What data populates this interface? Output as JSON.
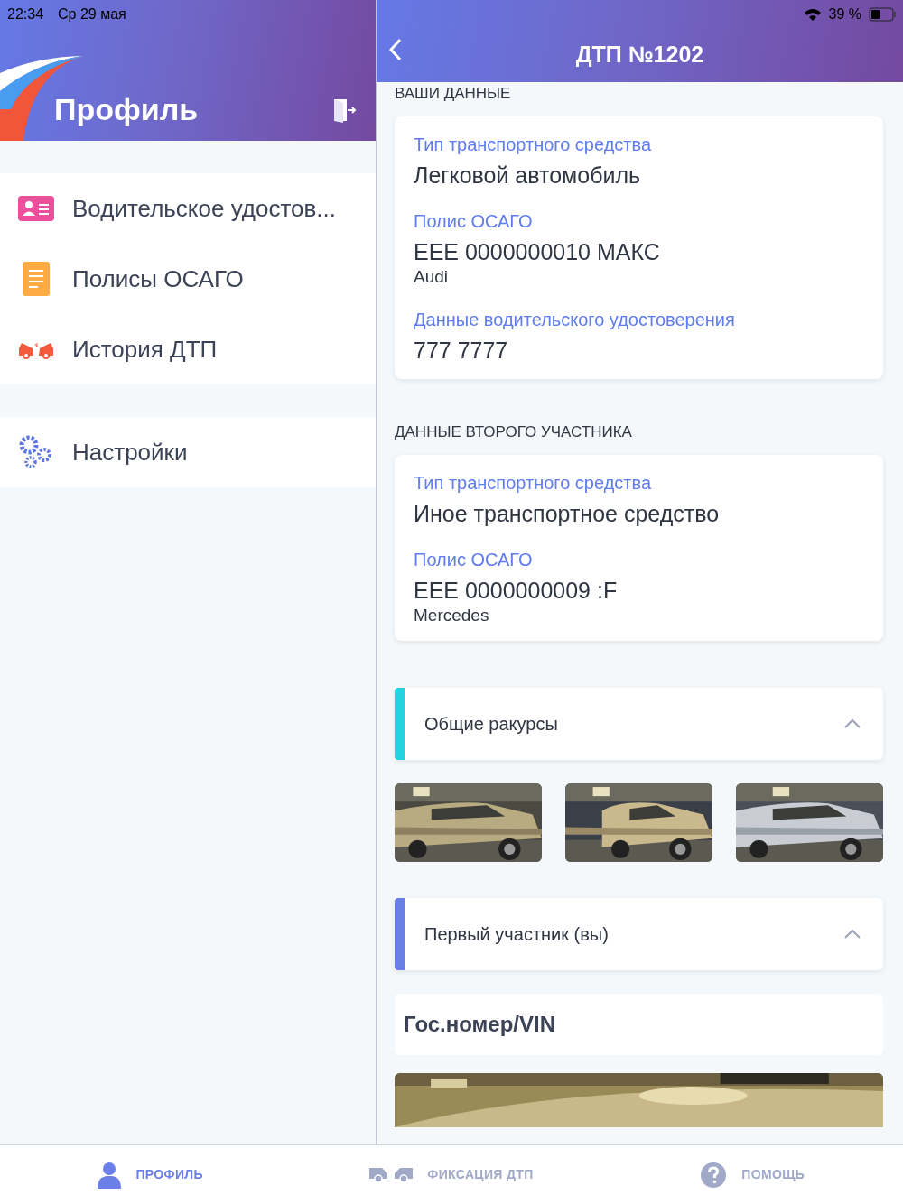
{
  "status_bar": {
    "time": "22:34",
    "date": "Ср 29 мая",
    "battery": "39 %"
  },
  "sidebar": {
    "title": "Профиль",
    "groups": [
      [
        {
          "kind": "license",
          "label": "Водительское удостов..."
        },
        {
          "kind": "policy",
          "label": "Полисы ОСАГО"
        },
        {
          "kind": "history",
          "label": "История ДТП"
        }
      ],
      [
        {
          "kind": "settings",
          "label": "Настройки"
        }
      ]
    ]
  },
  "detail": {
    "title": "ДТП №1202",
    "sections": [
      {
        "heading": "ВАШИ ДАННЫЕ",
        "fields": [
          {
            "label": "Тип транспортного средства",
            "value": "Легковой автомобиль"
          },
          {
            "label": "Полис ОСАГО",
            "value": "ЕЕЕ 0000000010 МАКС",
            "note": "Audi"
          },
          {
            "label": "Данные водительского удостоверения",
            "value": "777 7777"
          }
        ]
      },
      {
        "heading": "ДАННЫЕ ВТОРОГО УЧАСТНИКА",
        "fields": [
          {
            "label": "Тип транспортного средства",
            "value": "Иное транспортное средство"
          },
          {
            "label": "Полис ОСАГО",
            "value": "ЕЕЕ 0000000009 :F",
            "note": "Mercedes"
          }
        ]
      }
    ],
    "accordions": [
      {
        "title": "Общие ракурсы",
        "color": "#22d3e0",
        "expanded": true
      },
      {
        "title": "Первый участник (вы)",
        "color": "#6a7fe8",
        "expanded": true,
        "subsection": "Гос.номер/VIN"
      }
    ]
  },
  "tab_bar": [
    {
      "kind": "profile",
      "label": "ПРОФИЛЬ",
      "selected": true
    },
    {
      "kind": "accident",
      "label": "ФИКСАЦИЯ ДТП",
      "selected": false
    },
    {
      "kind": "help",
      "label": "ПОМОЩЬ",
      "selected": false
    }
  ]
}
